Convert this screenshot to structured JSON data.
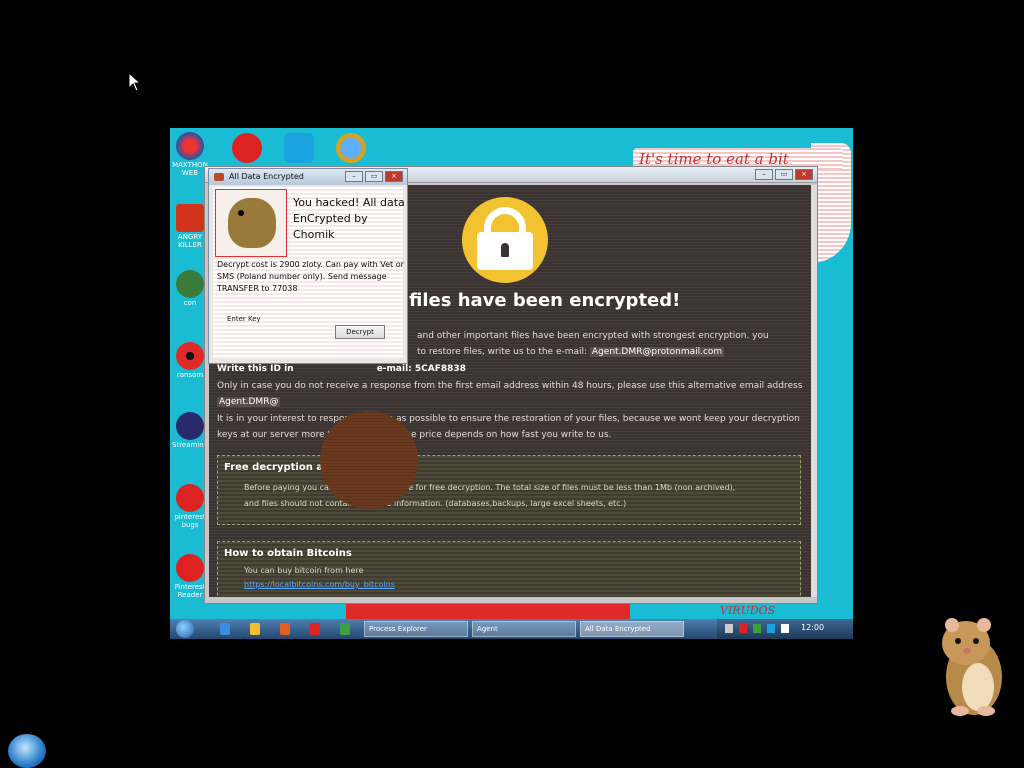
{
  "desktop": {
    "icons_left": [
      {
        "icon": "maxthon-icon",
        "label": "MAXTHON WEB"
      },
      {
        "icon": "app-icon",
        "label": "ANGRY KILLER"
      },
      {
        "icon": "network-icon",
        "label": "con"
      },
      {
        "icon": "radiation-icon",
        "label": "ransom"
      },
      {
        "icon": "flash-icon",
        "label": "Streaming"
      },
      {
        "icon": "pinterest-icon",
        "label": "pinterest bugs"
      },
      {
        "icon": "pinterest-icon",
        "label": "Pinterest Reader"
      }
    ],
    "icons_top": [
      "pinterest-icon",
      "skype-icon",
      "internet-explorer-icon"
    ],
    "wallpaper_text": "It's time to eat a bit",
    "strip_text": "VIRUDOS"
  },
  "ransom_note": {
    "heading": "files have been encrypted!",
    "line1": "and other important files have been encrypted with strongest encryption. you",
    "line2": "to restore files, write us to the e-mail:",
    "email": "Agent.DMR@protonmail.com",
    "line3": "Write this ID in",
    "id_label": "e-mail: 5CAF8838",
    "line4": "Only in case you do not receive a response from the first email address within 48 hours, please use this alternative email address",
    "alt_email": "Agent.DMR@",
    "line5": "It is in your interest to respond as soon as possible to ensure the restoration of your files, because we wont keep your decryption",
    "line6": "keys at our server more than one week. The price depends on how fast you write to us.",
    "free_title": "Free decryption as guarantee",
    "free_line1": "Before paying you can send us up to 1 file for free decryption. The total size of files must be less than 1Mb (non archived),",
    "free_line2": "and files should not contain valuable information. (databases,backups, large excel sheets, etc.)",
    "bitcoin_title": "How to obtain Bitcoins",
    "bitcoin_line": "You can buy bitcoin from here",
    "bitcoin_link": "https://localbitcoins.com/buy_bitcoins"
  },
  "dialog": {
    "title": "All Data Encrypted",
    "headline": "You hacked! All data EnCrypted by Chomik",
    "text": "Decrypt cost is 2900 zloty. Can pay with Vet or SMS (Poland number only). Send message TRANSFER to 77038",
    "key_label": "Enter Key",
    "decrypt_button": "Decrypt"
  },
  "taskbar": {
    "tasks": [
      "Process Explorer",
      "Agent",
      "All Data Encrypted"
    ],
    "clock": "12:00"
  },
  "colors": {
    "vm_background": "#19bcd2",
    "ransom_background": "#3b3331",
    "lock_yellow": "#f2c230",
    "link_blue": "#5aa7ff"
  }
}
